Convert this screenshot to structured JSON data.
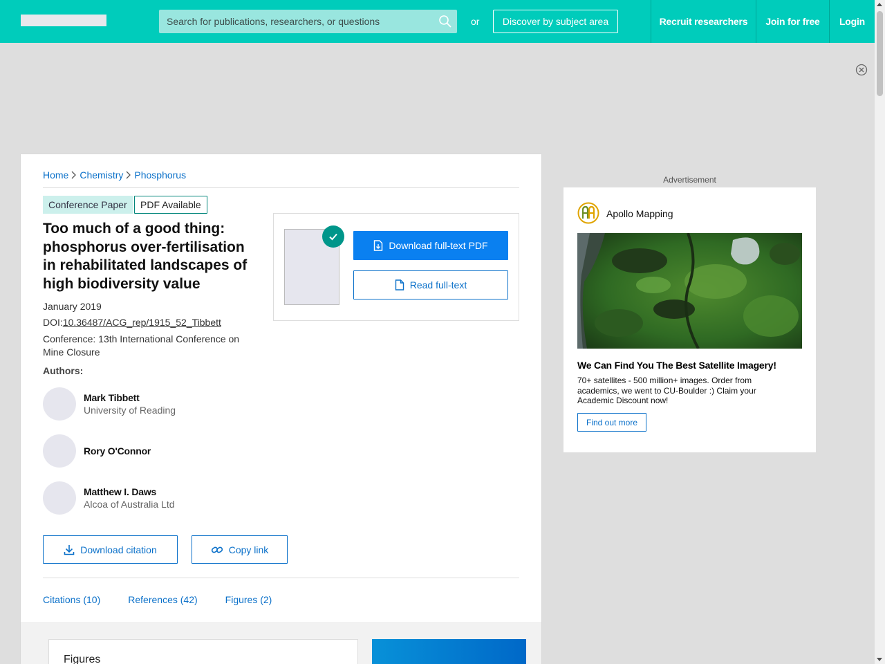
{
  "header": {
    "search_placeholder": "Search for publications, researchers, or questions",
    "or_label": "or",
    "discover_label": "Discover by subject area",
    "nav": [
      {
        "label": "Recruit researchers"
      },
      {
        "label": "Join for free"
      },
      {
        "label": "Login"
      }
    ]
  },
  "breadcrumb": [
    "Home",
    "Chemistry",
    "Phosphorus"
  ],
  "publication": {
    "type_tag": "Conference Paper",
    "availability_tag": "PDF Available",
    "title": "Too much of a good thing: phosphorus over-fertilisation in rehabilitated landscapes of high biodiversity value",
    "date": "January 2019",
    "doi_prefix": "DOI:",
    "doi": "10.36487/ACG_rep/1915_52_Tibbett",
    "conference": "Conference: 13th International Conference on Mine Closure",
    "authors_label": "Authors:",
    "authors": [
      {
        "name": "Mark Tibbett",
        "affiliation": "University of Reading"
      },
      {
        "name": "Rory O'Connor",
        "affiliation": ""
      },
      {
        "name": "Matthew I. Daws",
        "affiliation": "Alcoa of Australia Ltd"
      }
    ]
  },
  "actions": {
    "download_pdf": "Download full-text PDF",
    "read_fulltext": "Read full-text",
    "download_citation": "Download citation",
    "copy_link": "Copy link"
  },
  "tabs": [
    "Citations (10)",
    "References (42)",
    "Figures (2)"
  ],
  "figures_heading": "Figures",
  "ad": {
    "label": "Advertisement",
    "brand": "Apollo Mapping",
    "headline": "We Can Find You The Best Satellite Imagery!",
    "body": "70+ satellites - 500 million+ images. Order from academics, we went to CU-Boulder :) Claim your Academic Discount now!",
    "cta": "Find out more"
  },
  "colors": {
    "header_teal": "#00ccbb",
    "link_blue": "#0a70c9",
    "primary_button": "#0a80f0",
    "check_green": "#00968a"
  }
}
